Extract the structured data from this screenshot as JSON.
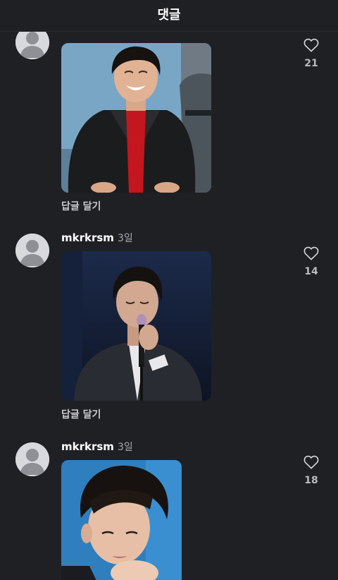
{
  "header": {
    "title": "댓글"
  },
  "comments": [
    {
      "username": "",
      "time": "",
      "reply_label": "답글 달기",
      "likes": "21",
      "photo_icon": "gif-photo-smiling-man-leather-jacket"
    },
    {
      "username": "mkrkrsm",
      "time": "3일",
      "reply_label": "답글 달기",
      "likes": "14",
      "photo_icon": "gif-photo-man-singing-microphone"
    },
    {
      "username": "mkrkrsm",
      "time": "3일",
      "reply_label": "",
      "likes": "18",
      "photo_icon": "gif-photo-man-portrait-blue-background"
    }
  ],
  "colors": {
    "background": "#1f2024",
    "avatar": "#d8d9dd",
    "avatar_figure": "#8e9096",
    "text_primary": "#ffffff",
    "text_secondary": "#a7a8ad"
  }
}
